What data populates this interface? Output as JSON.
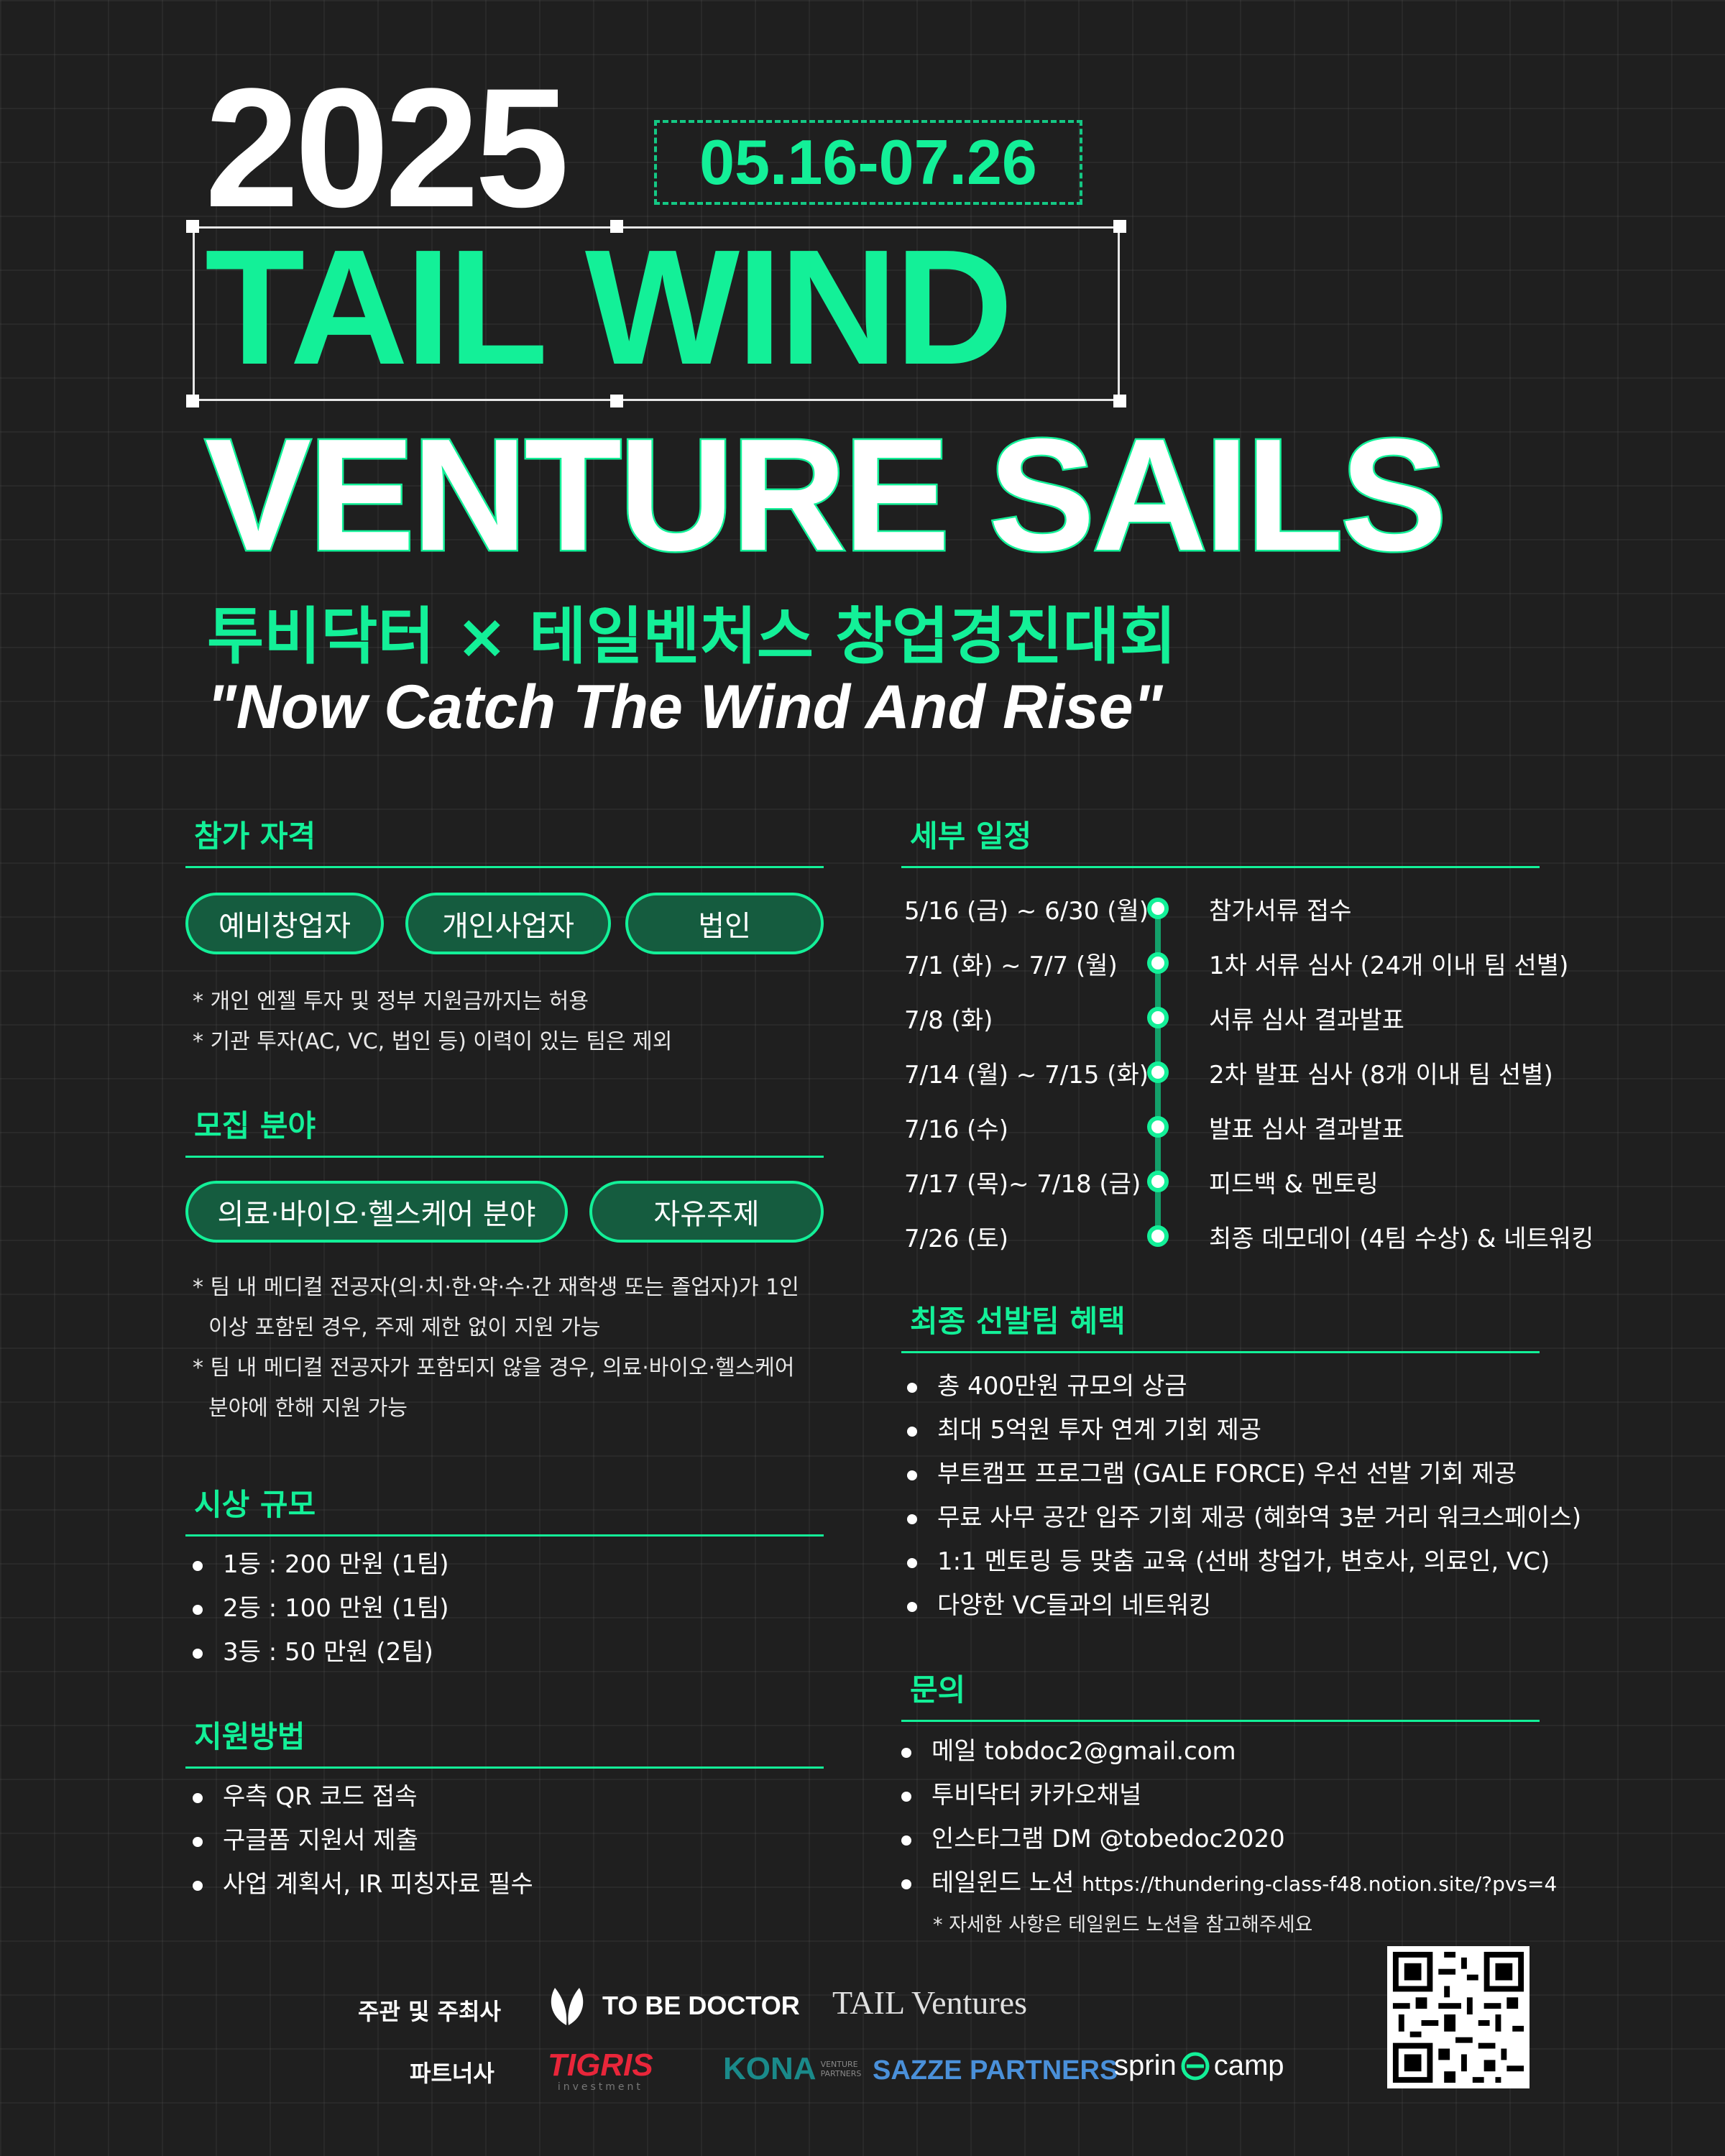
{
  "header": {
    "year": "2025",
    "dates": "05.16-07.26",
    "title_line1": "TAIL WIND",
    "title_line2": "VENTURE SAILS",
    "subtitle_kr": "투비닥터 × 테일벤처스 창업경진대회",
    "slogan": "\"Now Catch The Wind And Rise\""
  },
  "eligibility": {
    "title": "참가 자격",
    "pills": [
      "예비창업자",
      "개인사업자",
      "법인"
    ],
    "notes": [
      "* 개인 엔젤 투자 및 정부 지원금까지는 허용",
      "* 기관 투자(AC, VC, 법인 등) 이력이 있는 팀은 제외"
    ]
  },
  "fields": {
    "title": "모집 분야",
    "pills": [
      "의료·바이오·헬스케어 분야",
      "자유주제"
    ],
    "notes": [
      "* 팀 내 메디컬 전공자(의·치·한·약·수·간 재학생 또는 졸업자)가 1인",
      "이상 포함된 경우, 주제 제한 없이 지원 가능",
      "* 팀 내 메디컬 전공자가 포함되지 않을 경우, 의료·바이오·헬스케어",
      "분야에 한해 지원 가능"
    ]
  },
  "prizes": {
    "title": "시상 규모",
    "items": [
      "1등 : 200 만원 (1팀)",
      "2등 : 100 만원 (1팀)",
      "3등 : 50 만원 (2팀)"
    ]
  },
  "apply": {
    "title": "지원방법",
    "items": [
      "우측 QR 코드 접속",
      "구글폼 지원서 제출",
      "사업 계획서, IR 피칭자료 필수"
    ]
  },
  "schedule": {
    "title": "세부 일정",
    "rows": [
      {
        "date": "5/16 (금) ~ 6/30 (월)",
        "event": "참가서류 접수"
      },
      {
        "date": "7/1 (화) ~ 7/7 (월)",
        "event": "1차 서류 심사 (24개 이내  팀 선별)"
      },
      {
        "date": "7/8 (화)",
        "event": "서류 심사 결과발표"
      },
      {
        "date": "7/14 (월) ~ 7/15 (화)",
        "event": "2차 발표 심사 (8개 이내 팀 선별)"
      },
      {
        "date": "7/16 (수)",
        "event": "발표 심사 결과발표"
      },
      {
        "date": "7/17 (목)~ 7/18 (금)",
        "event": "피드백 & 멘토링"
      },
      {
        "date": "7/26 (토)",
        "event": "최종 데모데이 (4팀 수상) & 네트워킹"
      }
    ]
  },
  "benefits": {
    "title": "최종 선발팀 혜택",
    "items": [
      "총 400만원 규모의 상금",
      "최대 5억원 투자 연계 기회 제공",
      "부트캠프 프로그램 (GALE FORCE) 우선 선발 기회 제공",
      "무료 사무 공간 입주 기회 제공 (혜화역 3분 거리 워크스페이스)",
      "1:1 멘토링 등 맞춤 교육 (선배 창업가, 변호사, 의료인, VC)",
      "다양한 VC들과의 네트워킹"
    ]
  },
  "contact": {
    "title": "문의",
    "items": [
      {
        "text": "메일 tobdoc2@gmail.com",
        "small": ""
      },
      {
        "text": "투비닥터 카카오채널",
        "small": ""
      },
      {
        "text": "인스타그램 DM @tobedoc2020",
        "small": ""
      },
      {
        "text": "테일윈드 노션 ",
        "small": "https://thundering-class-f48.notion.site/?pvs=4"
      }
    ],
    "note": "* 자세한 사항은 테일윈드 노션을 참고해주세요"
  },
  "footer": {
    "organizers_label": "주관 및 주최사",
    "organizers": [
      "TO BE DOCTOR",
      "TAIL Ventures"
    ],
    "partners_label": "파트너사",
    "partners": [
      "TIGRIS",
      "investment",
      "KONA",
      "VENTURE PARTNERS",
      "SAZZE PARTNERS",
      "sprin",
      "camp"
    ]
  },
  "colors": {
    "accent": "#13f098",
    "background": "#1f1f1f",
    "pill_fill": "#155c3f"
  }
}
